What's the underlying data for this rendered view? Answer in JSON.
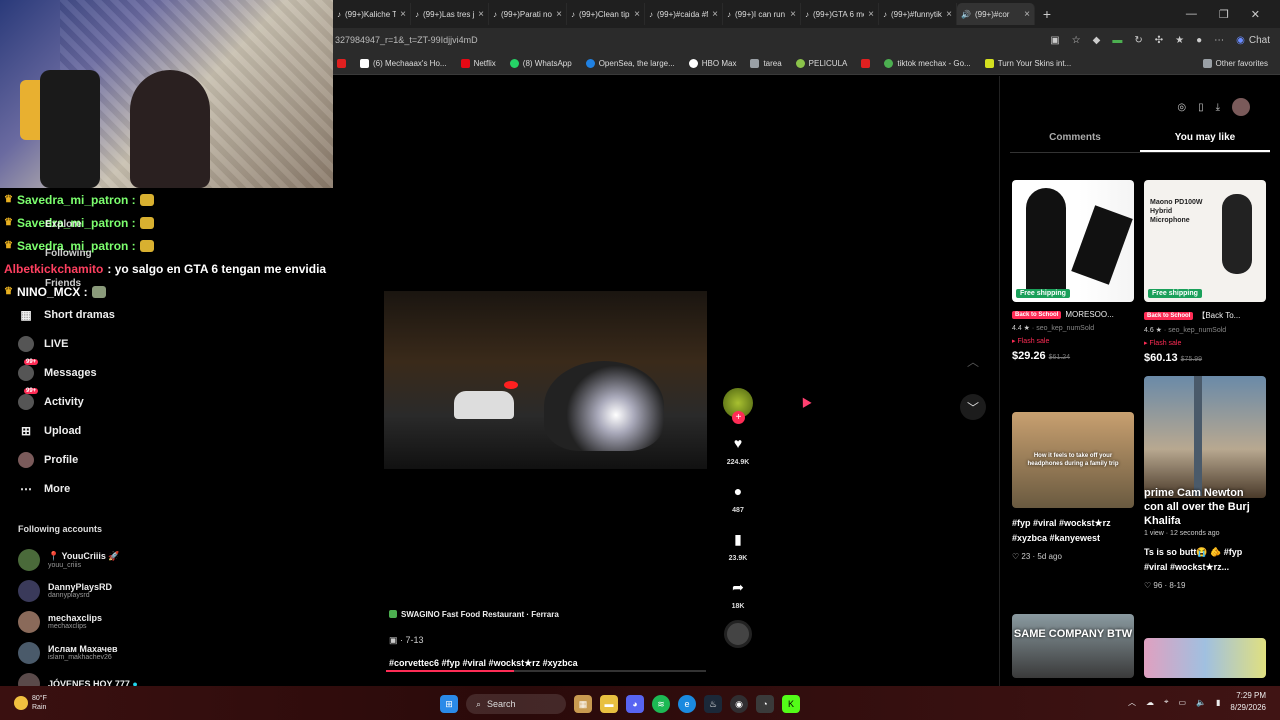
{
  "browser": {
    "tabs": [
      {
        "label": "(99+)Kaliche Ta"
      },
      {
        "label": "(99+)Las tres ju"
      },
      {
        "label": "(99+)Parati no"
      },
      {
        "label": "(99+)Clean tips"
      },
      {
        "label": "(99+)#caida #f"
      },
      {
        "label": "(99+)I can run"
      },
      {
        "label": "(99+)GTA 6 me"
      },
      {
        "label": "(99+)#funnytik"
      },
      {
        "label": "(99+)#cor"
      }
    ],
    "url": "327984947_r=1&_t=ZT-99Idjjvi4mD",
    "chat_label": "Chat",
    "bookmarks": [
      {
        "label": "(6) Mechaaax's Ho...",
        "color": "#ffffff"
      },
      {
        "label": "Netflix",
        "color": "#e50914"
      },
      {
        "label": "(8) WhatsApp",
        "color": "#25d366"
      },
      {
        "label": "OpenSea, the large...",
        "color": "#2081e2"
      },
      {
        "label": "HBO Max",
        "color": "#ffffff"
      },
      {
        "label": "tarea",
        "color": "#9aa0a6"
      },
      {
        "label": "PELICULA",
        "color": "#8bc34a"
      },
      {
        "label": "",
        "color": "#e02020"
      },
      {
        "label": "tiktok mechax - Go...",
        "color": "#4caf50"
      },
      {
        "label": "Turn Your Skins int...",
        "color": "#d4e020"
      }
    ],
    "other_favorites": "Other favorites"
  },
  "chat": [
    {
      "user": "Savedra_mi_patron :",
      "msg": "",
      "style": "green"
    },
    {
      "user": "Savedra_mi_patron :",
      "msg": "",
      "style": "green"
    },
    {
      "user": "Savedra_mi_patron :",
      "msg": "",
      "style": "green"
    },
    {
      "user": "Albetkickchamito",
      "msg": ": yo salgo en GTA 6 tengan me envidia",
      "style": "red"
    },
    {
      "user": "NINO_MCX :",
      "msg": "",
      "style": "white"
    }
  ],
  "nav": {
    "ghost_explore": "Explore",
    "ghost_following": "Following",
    "ghost_friends": "Friends",
    "items": [
      {
        "label": "Short dramas",
        "icon": "drama-icon"
      },
      {
        "label": "LIVE",
        "icon": "live-icon"
      },
      {
        "label": "Messages",
        "icon": "messages-icon",
        "badge": "99+"
      },
      {
        "label": "Activity",
        "icon": "activity-icon",
        "badge": "99+"
      },
      {
        "label": "Upload",
        "icon": "upload-icon"
      },
      {
        "label": "Profile",
        "icon": "profile-icon"
      },
      {
        "label": "More",
        "icon": "more-icon"
      }
    ],
    "following_heading": "Following accounts",
    "accounts": [
      {
        "name": "📍 YouuCriiis 🚀",
        "user": "youu_criiis"
      },
      {
        "name": "DannyPlaysRD",
        "user": "dannyplaysrd"
      },
      {
        "name": "mechaxclips",
        "user": "mechaxclips"
      },
      {
        "name": "Ислам Махачев",
        "user": "islam_makhachev26"
      },
      {
        "name": "JÓVENES HOY 777",
        "user": ""
      }
    ]
  },
  "video": {
    "location": "SWAGINO Fast Food Restaurant · Ferrara",
    "date": "· 7-13",
    "caption": "#corvettec6 #fyp #viral #wockst★rz #xyzbca",
    "progress": 0.4
  },
  "actions": {
    "likes": "224.9K",
    "comments": "487",
    "saves": "23.9K",
    "shares": "18K"
  },
  "right_panel": {
    "tab_comments": "Comments",
    "tab_you_may_like": "You may like",
    "products": [
      {
        "badge": "Back to School",
        "title": "MORESOO...",
        "rating": "4.4 ★",
        "sold": "seo_kep_numSold",
        "flash": "Flash sale",
        "price": "$29.26",
        "old_price": "$61.24",
        "shipping": "Free shipping"
      },
      {
        "badge": "Back to School",
        "title": "【Back To...",
        "rating": "4.6 ★",
        "sold": "seo_kep_numSold",
        "flash": "Flash sale",
        "price": "$60.13",
        "old_price": "$75.99",
        "shipping": "Free shipping",
        "thumb_text": "Maono PD100W Hybrid Microphone"
      }
    ],
    "videos": [
      {
        "caption": "#fyp #viral #wockst★rz #xyzbca #kanyewest",
        "likes": "23",
        "age": "5d ago",
        "overlay": "How it feels to take off your headphones during a family trip"
      },
      {
        "caption": "Ts is so butt😭 🫵 #fyp #viral #wockst★rz...",
        "likes": "96",
        "age": "8-19",
        "overlay": "prime Cam Newton con all over the Burj Khalifa",
        "overlay_sub": "1 view · 12 seconds ago"
      },
      {
        "overlay": "SAME COMPANY BTW"
      }
    ]
  },
  "taskbar": {
    "temp": "80°F",
    "weather": "Rain",
    "search": "Search",
    "time": "7:29 PM",
    "date": "8/29/2026"
  }
}
